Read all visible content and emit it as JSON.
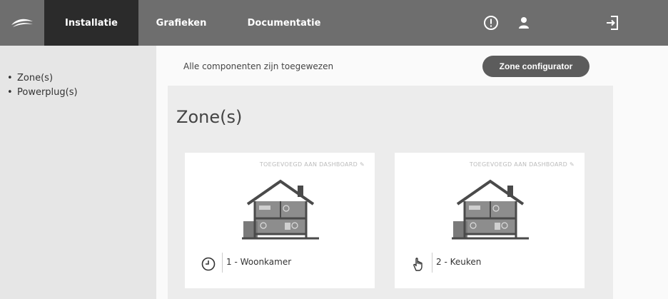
{
  "nav": {
    "tabs": [
      {
        "label": "Installatie",
        "active": true
      },
      {
        "label": "Grafieken",
        "active": false
      },
      {
        "label": "Documentatie",
        "active": false
      }
    ],
    "icons": [
      "alert-icon",
      "user-icon",
      "logout-icon"
    ]
  },
  "sidebar": {
    "items": [
      {
        "label": "Zone(s)"
      },
      {
        "label": "Powerplug(s)"
      }
    ]
  },
  "main": {
    "status": "Alle componenten zijn toegewezen",
    "zone_config_label": "Zone configurator",
    "section_title": "Zone(s)",
    "cards": [
      {
        "badge": "TOEGEVOEGD AAN DASHBOARD",
        "mode_icon": "schedule-clock-icon",
        "name": "1 - Woonkamer"
      },
      {
        "badge": "TOEGEVOEGD AAN DASHBOARD",
        "mode_icon": "manual-hand-icon",
        "name": "2 - Keuken"
      }
    ]
  },
  "colors": {
    "topbar": "#6e6e6e",
    "active_tab": "#2b2b2b",
    "sidebar": "#e6e6e6",
    "button": "#5c5c5c"
  }
}
